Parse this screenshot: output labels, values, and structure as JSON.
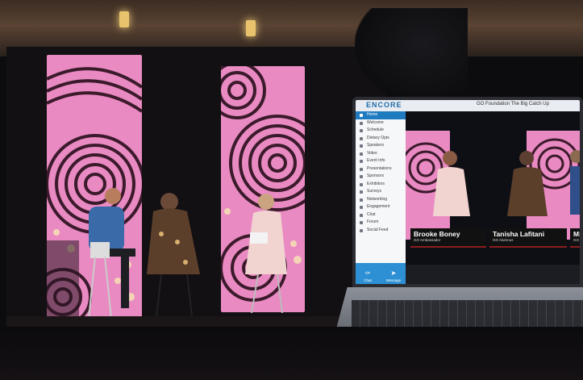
{
  "laptop_screen": {
    "brand": "ENCORE",
    "window_title": "GO Foundation The Big Catch Up",
    "nav": [
      "Home",
      "Welcome",
      "Schedule",
      "Dietary Opts",
      "Speakers",
      "Video",
      "Event Info",
      "Presentations",
      "Sponsors",
      "Exhibitors",
      "Surveys",
      "Networking",
      "Engagement",
      "Chat",
      "Forum",
      "Social Feed"
    ],
    "active_nav": "Home",
    "footer": {
      "left": "Chat",
      "right": "Message"
    },
    "lower_thirds": [
      {
        "name": "Brooke Boney",
        "subtitle": "GO Ambassador"
      },
      {
        "name": "Tanisha Lafitani",
        "subtitle": "GO Alumnus"
      },
      {
        "name": "Mit",
        "subtitle": "GO"
      }
    ]
  },
  "colors": {
    "accent": "#1f7bc0",
    "panel_pink": "#e98ac2",
    "panel_dark": "#2a1522",
    "lower_third_bar": "#8b1d20"
  }
}
